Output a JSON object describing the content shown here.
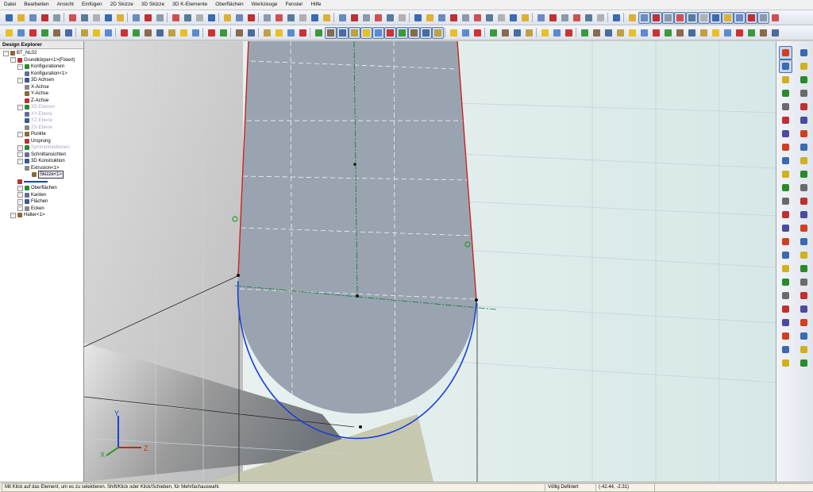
{
  "menu": [
    "Datei",
    "Bearbeiten",
    "Ansicht",
    "Einfügen",
    "2D Skizze",
    "3D Skizze",
    "3D K-Elemente",
    "Oberflächen",
    "Werkzeuge",
    "Fenster",
    "Hilfe"
  ],
  "explorer": {
    "title": "Design Explorer",
    "items": [
      {
        "label": "BT_NL02",
        "level": 0
      },
      {
        "label": "Grundkörper<1>(Fixiert)",
        "level": 1
      },
      {
        "label": "Konfigurationen",
        "level": 2
      },
      {
        "label": "Konfiguration<1>",
        "level": 3
      },
      {
        "label": "3D Achsen",
        "level": 2
      },
      {
        "label": "X-Achse",
        "level": 3
      },
      {
        "label": "Y-Achse",
        "level": 3
      },
      {
        "label": "Z-Achse",
        "level": 3
      },
      {
        "label": "3D Ebenen",
        "level": 2
      },
      {
        "label": "XY-Ebene",
        "level": 3
      },
      {
        "label": "YZ-Ebene",
        "level": 3
      },
      {
        "label": "ZX-Ebene",
        "level": 3
      },
      {
        "label": "Punkte",
        "level": 2
      },
      {
        "label": "Ursprung",
        "level": 3
      },
      {
        "label": "Symmetrieebenen",
        "level": 2
      },
      {
        "label": "Schnittansichten",
        "level": 2
      },
      {
        "label": "3D Konstruktion",
        "level": 2
      },
      {
        "label": "Extrusion<1>",
        "level": 3
      },
      {
        "label": "Skizze<1>",
        "level": 4
      },
      {
        "label": "",
        "level": 2
      },
      {
        "label": "Oberflächen",
        "level": 2
      },
      {
        "label": "Kanten",
        "level": 2
      },
      {
        "label": "Flächen",
        "level": 2
      },
      {
        "label": "Ecken",
        "level": 2
      },
      {
        "label": "Halter<1>",
        "level": 1
      }
    ]
  },
  "axes": {
    "y": "Y",
    "x": "X",
    "z": "Z"
  },
  "status": {
    "hint": "Mit Klick auf das Element, um es zu selektieren. Shift/Klick oder Klick/Schieben, für Mehrfachauswahl.",
    "state": "Völlig Definiert",
    "coords": "(-42.44, -2.31)"
  },
  "colors": {
    "face": "#9aa4b1",
    "edge_red": "#d02020",
    "edge_blue": "#1a3fd8",
    "accent": "#4a6fa5"
  },
  "icons": [
    "part-icon",
    "save-icon",
    "cut-icon",
    "copy-icon",
    "paste-icon",
    "delete-icon",
    "undo-icon",
    "redo-icon",
    "zoom-icon",
    "view-icon"
  ]
}
